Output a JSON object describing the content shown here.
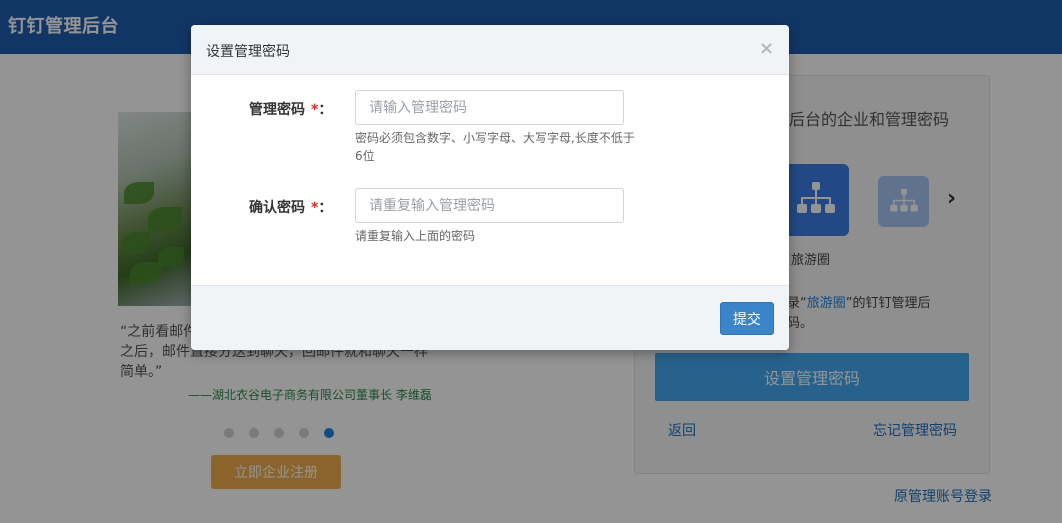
{
  "header": {
    "title": "钉钉管理后台"
  },
  "left_panel": {
    "quote_lines": [
      "“之前看邮件",
      "之后，邮件直接分送到聊天，回邮件就和聊天一样",
      "简单。”"
    ],
    "quote_author": "——湖北衣谷电子商务有限公司董事长 李维磊",
    "carousel_active_index": 4,
    "register_label": "立即企业注册"
  },
  "right_panel": {
    "heading": "后台的企业和管理密码",
    "org_name": "旅游圈",
    "hint_prefix": "录“",
    "hint_link": "旅游圈",
    "hint_suffix": "”的钉钉管理后",
    "hint_line2": "码。",
    "chevron": "›",
    "set_password_label": "设置管理密码",
    "back_label": "返回",
    "forgot_label": "忘记管理密码",
    "original_login_label": "原管理账号登录"
  },
  "modal": {
    "title": "设置管理密码",
    "close": "×",
    "password_label": "管理密码",
    "password_required": "*",
    "password_colon": "：",
    "password_placeholder": "请输入管理密码",
    "password_help": "密码必须包含数字、小写字母、大写字母,长度不低于6位",
    "confirm_label": "确认密码",
    "confirm_required": "*",
    "confirm_colon": "：",
    "confirm_placeholder": "请重复输入管理密码",
    "confirm_help": "请重复输入上面的密码",
    "submit_label": "提交"
  },
  "colors": {
    "header": "#1e5eb0",
    "primary": "#42aaf2",
    "submit": "#3a84c9",
    "register": "#f0ad4e",
    "required": "#e0281f",
    "link": "#1f6fc0"
  }
}
